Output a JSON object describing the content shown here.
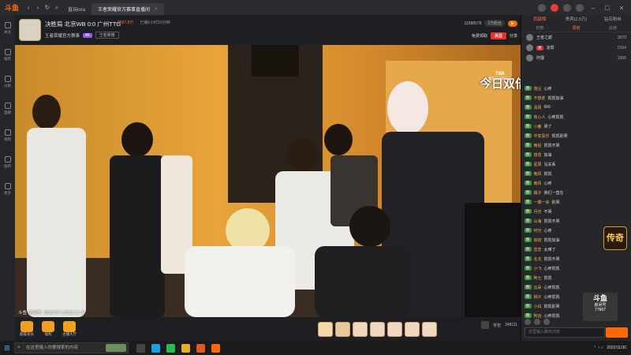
{
  "titlebar": {
    "logo": "斗鱼",
    "tabs": [
      {
        "label": "直玩lora",
        "active": false
      },
      {
        "label": "王者荣耀官方赛事直播间",
        "active": true
      }
    ]
  },
  "sidebar": {
    "items": [
      {
        "label": "关注",
        "icon": "heart-icon"
      },
      {
        "label": "推荐",
        "icon": "thumb-icon"
      },
      {
        "label": "分类",
        "icon": "grid-icon"
      },
      {
        "label": "直播",
        "icon": "tv-icon"
      },
      {
        "label": "视频",
        "icon": "play-icon"
      },
      {
        "label": "鱼吧",
        "icon": "chat-icon"
      },
      {
        "label": "更多",
        "icon": "more-icon"
      }
    ]
  },
  "header": {
    "title": "决胜局 北京WB 0:0 广州TTG",
    "meta": [
      "2597.8万",
      "已播6小时15分钟"
    ],
    "anchor_name": "王者荣耀官方赛事",
    "level": "46",
    "category": "王者荣耀",
    "room_num": "11588078",
    "fans": "2万粉丝",
    "follow_label": "免费领取",
    "subscribe_label": "关注",
    "share_label": "分享"
  },
  "video": {
    "brand_top": "TiMi",
    "brand_bottom": "ESPORTS",
    "overlay": "今日双倍",
    "room_id": "斗鱼 房间号: 1863767 | 2022.11.30"
  },
  "bottombar": {
    "left_items": [
      "超级会员",
      "福利",
      "主播大厅"
    ],
    "counter": "348111",
    "backpack": "背包"
  },
  "rpanel": {
    "tabs": [
      "贡献榜",
      "贵宾(2.5万)",
      "钻石粉丝"
    ],
    "subtabs": [
      "日榜",
      "周榜",
      "总榜"
    ],
    "ranks": [
      {
        "name": "王者之巅",
        "score": "3670"
      },
      {
        "name": "凌霄",
        "score": "2104"
      },
      {
        "name": "阿狸",
        "score": "1506"
      }
    ],
    "chat": [
      {
        "name": "落尘",
        "text": "心疼"
      },
      {
        "name": "不想走",
        "text": "凯凯加油"
      },
      {
        "name": "清风",
        "text": "666"
      },
      {
        "name": "有心人",
        "text": "心疼凯凯"
      },
      {
        "name": "小鹿",
        "text": "哭了"
      },
      {
        "name": "平安喜乐",
        "text": "凯凯别哭"
      },
      {
        "name": "雨后",
        "text": "凯凯不哭"
      },
      {
        "name": "想念",
        "text": "加油"
      },
      {
        "name": "星辰",
        "text": "没关系"
      },
      {
        "name": "晚风",
        "text": "凯凯"
      },
      {
        "name": "南风",
        "text": "心疼"
      },
      {
        "name": "橘子",
        "text": "我们一直在"
      },
      {
        "name": "一期一会",
        "text": "别哭"
      },
      {
        "name": "月光",
        "text": "不哭"
      },
      {
        "name": "山海",
        "text": "凯凯不哭"
      },
      {
        "name": "时光",
        "text": "心疼"
      },
      {
        "name": "如初",
        "text": "凯凯加油"
      },
      {
        "name": "念念",
        "text": "太难了"
      },
      {
        "name": "北北",
        "text": "凯凯不哭"
      },
      {
        "name": "小飞",
        "text": "心疼凯凯"
      },
      {
        "name": "阿七",
        "text": "凯凯"
      },
      {
        "name": "云朵",
        "text": "心疼凯凯"
      },
      {
        "name": "桃子",
        "text": "心疼凯凯"
      },
      {
        "name": "小白",
        "text": "凯凯别哭"
      },
      {
        "name": "阿远",
        "text": "心疼凯凯"
      }
    ],
    "input_placeholder": "这里输入聊天内容",
    "promo": "传奇",
    "watermark": {
      "logo": "斗鱼",
      "label": "房间号",
      "id": "77667"
    }
  },
  "taskbar": {
    "search_placeholder": "在这里输入你要搜索的内容",
    "time": "",
    "date": "2022/11/30"
  }
}
